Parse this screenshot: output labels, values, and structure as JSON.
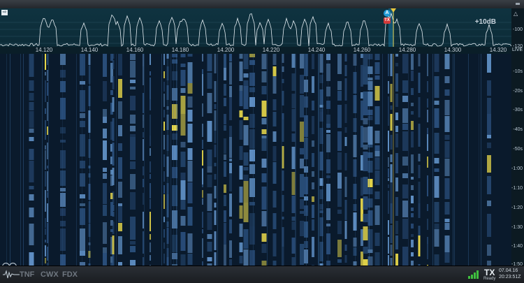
{
  "panadapter": {
    "ref_level": "+10dB",
    "db_labels": [
      "-100",
      "-120"
    ],
    "freq_labels": [
      "14.120",
      "14.140",
      "14.160",
      "14.180",
      "14.200",
      "14.220",
      "14.240",
      "14.260",
      "14.280",
      "14.300",
      "14.320"
    ],
    "live_label": "LIVE"
  },
  "markers": {
    "slice_label": "A",
    "tx_label": "TX"
  },
  "waterfall": {
    "time_labels": [
      "-10s",
      "-20s",
      "-30s",
      "-40s",
      "-50s",
      "-1:00",
      "-1:10",
      "-1:20",
      "-1:30",
      "-1:40",
      "-1:50"
    ]
  },
  "statusbar": {
    "modes": [
      "TNF",
      "CWX",
      "FDX"
    ],
    "tx_big": "TX",
    "tx_small": "Ready",
    "date": "07.04.16",
    "time": "20:23:51Z"
  },
  "colors": {
    "accent": "#e9c840",
    "trace": "#e6eef3",
    "tx_badge": "#d23a3a",
    "slice_badge": "#1e9ad6"
  }
}
